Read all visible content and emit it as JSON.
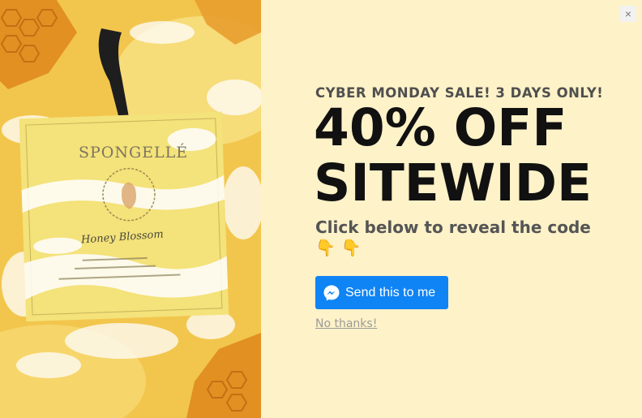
{
  "popup": {
    "eyebrow": "CYBER MONDAY SALE! 3 DAYS ONLY!",
    "headline_line1": "40% OFF",
    "headline_line2": "SITEWIDE",
    "subline": "Click below to reveal the code 👇 👇",
    "send_button_label": "Send this to me",
    "send_button_icon": "messenger-icon",
    "decline_label": "No thanks!",
    "close_label": "×",
    "close_icon": "close-icon"
  },
  "product_image": {
    "brand": "SPONGELLÉ",
    "product_name": "Honey Blossom"
  },
  "colors": {
    "background": "#fef2c8",
    "button": "#0f84f5",
    "headline": "#111111",
    "subtext": "#555555",
    "link": "#9a9a9a"
  }
}
